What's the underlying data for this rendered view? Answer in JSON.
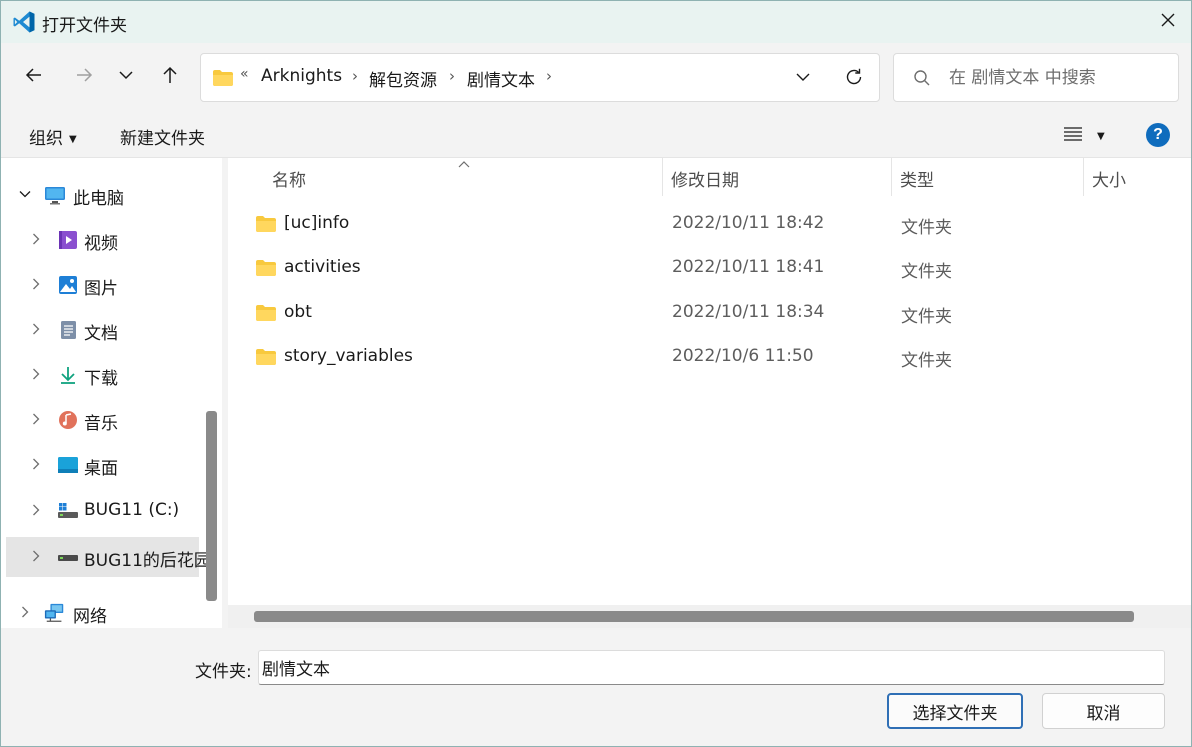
{
  "window": {
    "title": "打开文件夹",
    "icon": "vscode-icon",
    "accent": "#0f6cbd"
  },
  "navbar": {
    "back_icon": "back-arrow-icon",
    "forward_icon": "forward-arrow-icon",
    "recent_icon": "chevron-down-icon",
    "up_icon": "up-arrow-icon",
    "breadcrumb": {
      "overflow": "«",
      "segments": [
        "Arknights",
        "解包资源",
        "剧情文本"
      ],
      "separator": "›"
    },
    "search": {
      "placeholder": "在 剧情文本 中搜索"
    }
  },
  "toolbar": {
    "organize_label": "组织",
    "new_folder_label": "新建文件夹",
    "help_label": "?"
  },
  "navpane": {
    "items": [
      {
        "label": "此电脑",
        "icon": "pc-icon"
      },
      {
        "label": "视频",
        "icon": "video-icon"
      },
      {
        "label": "图片",
        "icon": "pictures-icon"
      },
      {
        "label": "文档",
        "icon": "documents-icon"
      },
      {
        "label": "下载",
        "icon": "download-icon"
      },
      {
        "label": "音乐",
        "icon": "music-icon"
      },
      {
        "label": "桌面",
        "icon": "desktop-icon"
      },
      {
        "label": "BUG11 (C:)",
        "icon": "drive-c-icon"
      },
      {
        "label": "BUG11的后花园",
        "icon": "network-drive-icon"
      },
      {
        "label": "网络",
        "icon": "network-icon"
      }
    ]
  },
  "filelist": {
    "columns": [
      "名称",
      "修改日期",
      "类型",
      "大小"
    ],
    "sort_indicator": "^",
    "rows": [
      {
        "name": "[uc]info",
        "date": "2022/10/11 18:42",
        "type": "文件夹"
      },
      {
        "name": "activities",
        "date": "2022/10/11 18:41",
        "type": "文件夹"
      },
      {
        "name": "obt",
        "date": "2022/10/11 18:34",
        "type": "文件夹"
      },
      {
        "name": "story_variables",
        "date": "2022/10/6 11:50",
        "type": "文件夹"
      }
    ]
  },
  "footer": {
    "folder_label": "文件夹:",
    "folder_value": "剧情文本",
    "select_button": "选择文件夹",
    "cancel_button": "取消"
  }
}
